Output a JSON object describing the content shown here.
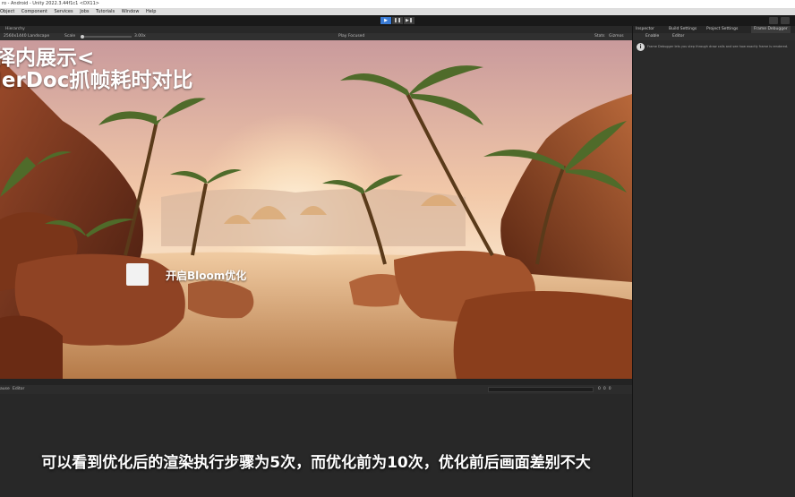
{
  "window": {
    "title": "ro - Android - Unity 2022.3.44f1c1 <DX11>"
  },
  "menu": [
    "Object",
    "Component",
    "Services",
    "Jobs",
    "Tutorials",
    "Window",
    "Help"
  ],
  "playbar": {
    "play": "▶",
    "pause": "❚❚",
    "step": "▶❚"
  },
  "scene": {
    "hierarchy_tab": "Hierarchy"
  },
  "game_toolbar": {
    "resolution": "2560x1440 Landscape",
    "scale_label": "Scale",
    "scale_value": "3.00x",
    "play_mode": "Play Focused",
    "stats": "Stats",
    "gizmos": "Gizmos"
  },
  "overlay": {
    "line1": "择内展示<",
    "line2": "lerDoc抓帧耗时对比",
    "bloom_label": "开启Bloom优化"
  },
  "console": {
    "pause": "ause",
    "editor": "Editor",
    "counts": [
      "0",
      "0",
      "0"
    ]
  },
  "inspector": {
    "tabs": [
      "Inspector",
      "Build Settings",
      "Project Settings",
      "Frame Debugger"
    ],
    "toolbar": {
      "enable": "Enable",
      "editor": "Editor"
    },
    "info_text": "Frame Debugger lets you step through draw calls and see how exactly frame is rendered."
  },
  "subtitle": "可以看到优化后的渲染执行步骤为5次，而优化前为10次，优化前后画面差别不大"
}
